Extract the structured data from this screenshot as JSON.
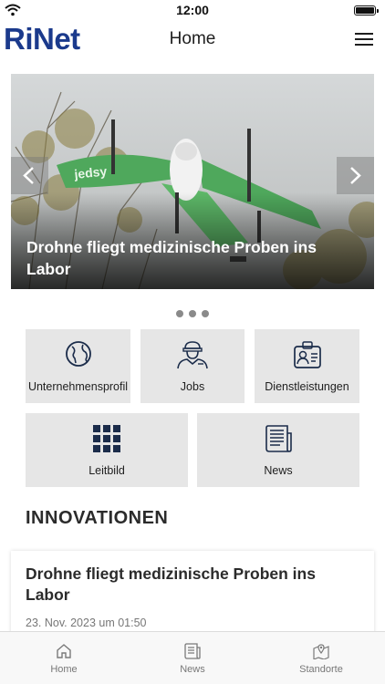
{
  "status_bar": {
    "time": "12:00"
  },
  "header": {
    "logo": "RiNet",
    "title": "Home"
  },
  "carousel": {
    "caption": "Drohne fliegt medizinische Proben ins Labor",
    "slide_count": 3,
    "active_slide": 1
  },
  "tiles": [
    {
      "label": "Unternehmensprofil",
      "icon": "globe-icon"
    },
    {
      "label": "Jobs",
      "icon": "worker-icon"
    },
    {
      "label": "Dienstleistungen",
      "icon": "id-card-icon"
    },
    {
      "label": "Leitbild",
      "icon": "grid-icon"
    },
    {
      "label": "News",
      "icon": "newspaper-icon"
    }
  ],
  "section": {
    "title": "INNOVATIONEN"
  },
  "news": [
    {
      "title": "Drohne fliegt medizinische Proben ins Labor",
      "date": "23. Nov. 2023 um 01:50"
    }
  ],
  "tabbar": [
    {
      "label": "Home",
      "icon": "home-icon"
    },
    {
      "label": "News",
      "icon": "newspaper-icon"
    },
    {
      "label": "Standorte",
      "icon": "map-pin-icon"
    }
  ],
  "colors": {
    "brand": "#1b3a8c",
    "tile_bg": "#e6e6e6",
    "icon_dark": "#1b2c4a"
  }
}
